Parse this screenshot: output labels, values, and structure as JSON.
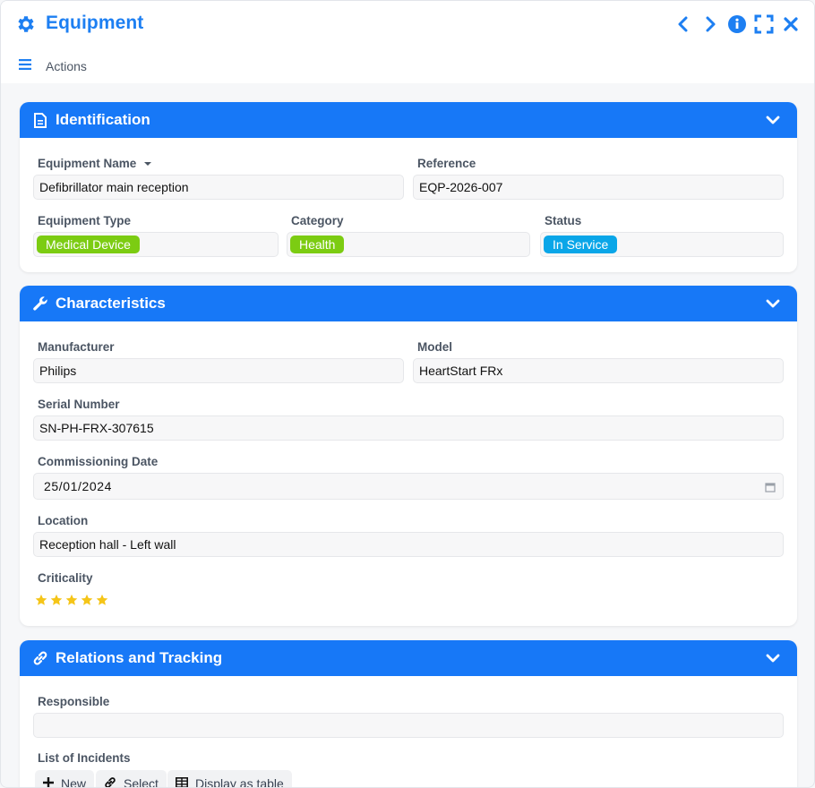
{
  "window": {
    "title": "Equipment",
    "actions_label": "Actions",
    "accent_color": "#1d7ff2",
    "icons": [
      "gear-icon",
      "chevron-left-icon",
      "chevron-right-icon",
      "info-icon",
      "fullscreen-icon",
      "close-icon",
      "hamburger-menu-icon"
    ]
  },
  "identification": {
    "title": "Identification",
    "equipment_name_label": "Equipment Name",
    "equipment_name": "Defibrillator main reception",
    "reference_label": "Reference",
    "reference": "EQP-2026-007",
    "equipment_type_label": "Equipment Type",
    "equipment_type": "Medical Device",
    "equipment_type_color": "#7ccc12",
    "category_label": "Category",
    "category": "Health",
    "category_color": "#7ccc12",
    "status_label": "Status",
    "status": "In Service",
    "status_color": "#0aa6e8"
  },
  "characteristics": {
    "title": "Characteristics",
    "manufacturer_label": "Manufacturer",
    "manufacturer": "Philips",
    "model_label": "Model",
    "model": "HeartStart FRx",
    "serial_label": "Serial Number",
    "serial": "SN-PH-FRX-307615",
    "commissioning_label": "Commissioning Date",
    "commissioning_date": "25/01/2024",
    "location_label": "Location",
    "location": "Reception hall - Left wall",
    "criticality_label": "Criticality",
    "criticality_stars": 5,
    "criticality_max": 5,
    "star_color": "#f5c518"
  },
  "relations": {
    "title": "Relations and Tracking",
    "responsible_label": "Responsible",
    "responsible": "",
    "incidents_label": "List of Incidents",
    "new_label": "New",
    "select_label": "Select",
    "table_label": "Display as table"
  }
}
